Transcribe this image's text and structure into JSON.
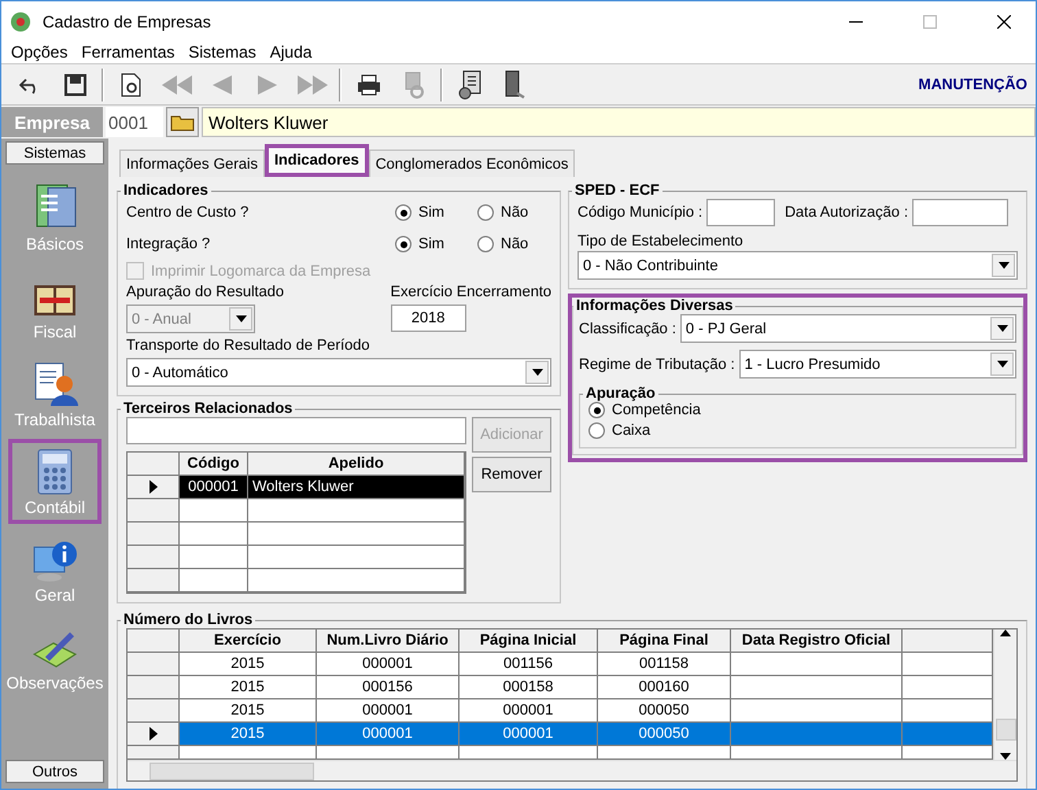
{
  "window": {
    "title": "Cadastro de Empresas"
  },
  "menu": [
    {
      "label": "Opções"
    },
    {
      "label": "Ferramentas"
    },
    {
      "label": "Sistemas"
    },
    {
      "label": "Ajuda"
    }
  ],
  "toolbar": {
    "buttons": [
      {
        "kind": "undo",
        "disabled": false
      },
      {
        "kind": "save",
        "disabled": false
      },
      {
        "kind": "sep"
      },
      {
        "kind": "preview",
        "disabled": false
      },
      {
        "kind": "first",
        "disabled": true
      },
      {
        "kind": "prev",
        "disabled": true
      },
      {
        "kind": "next",
        "disabled": true
      },
      {
        "kind": "last",
        "disabled": true
      },
      {
        "kind": "sep"
      },
      {
        "kind": "print",
        "disabled": false
      },
      {
        "kind": "tools",
        "disabled": true
      },
      {
        "kind": "sep"
      },
      {
        "kind": "report",
        "disabled": false
      },
      {
        "kind": "exit",
        "disabled": false
      }
    ],
    "mode": "MANUTENÇÃO"
  },
  "company": {
    "label": "Empresa",
    "code": "0001",
    "name": "Wolters Kluwer"
  },
  "sidebar": {
    "header": "Sistemas",
    "footer": "Outros",
    "items": [
      {
        "label": "Básicos",
        "kind": "basicos",
        "highlighted": false
      },
      {
        "label": "Fiscal",
        "kind": "fiscal",
        "highlighted": false
      },
      {
        "label": "Trabalhista",
        "kind": "trabalhista",
        "highlighted": false
      },
      {
        "label": "Contábil",
        "kind": "contabil",
        "highlighted": true
      },
      {
        "label": "Geral",
        "kind": "geral",
        "highlighted": false
      },
      {
        "label": "Observações",
        "kind": "observacoes",
        "highlighted": false
      }
    ]
  },
  "tabs": [
    {
      "label": "Informações Gerais",
      "selected": false,
      "highlighted": false
    },
    {
      "label": "Indicadores",
      "selected": true,
      "highlighted": true
    },
    {
      "label": "Conglomerados Econômicos",
      "selected": false,
      "highlighted": false
    }
  ],
  "indicadores": {
    "title": "Indicadores",
    "questions": [
      {
        "label": "Centro de Custo ?",
        "options": [
          {
            "label": "Sim",
            "selected": true
          },
          {
            "label": "Não",
            "selected": false
          }
        ]
      },
      {
        "label": "Integração ?",
        "options": [
          {
            "label": "Sim",
            "selected": true
          },
          {
            "label": "Não",
            "selected": false
          }
        ]
      }
    ],
    "logo_checkbox": {
      "label": "Imprimir Logomarca da Empresa",
      "checked": false,
      "disabled": true
    },
    "apuracao": {
      "label": "Apuração do Resultado",
      "value": "0 - Anual",
      "disabled": true
    },
    "exercicio": {
      "label": "Exercício Encerramento",
      "value": "2018"
    },
    "transporte": {
      "label": "Transporte do Resultado de Período",
      "value": "0 - Automático"
    }
  },
  "terceiros": {
    "title": "Terceiros Relacionados",
    "add_button": {
      "label": "Adicionar",
      "disabled": true
    },
    "remove_button": {
      "label": "Remover",
      "disabled": false
    },
    "columns": [
      "Código",
      "Apelido"
    ],
    "rows": [
      {
        "cells": [
          "000001",
          "Wolters Kluwer"
        ],
        "selected": true
      }
    ]
  },
  "sped": {
    "title": "SPED - ECF",
    "codigo_label": "Código Município :",
    "data_label": "Data Autorização :",
    "tipo_label": "Tipo de Estabelecimento",
    "tipo_value": "0 - Não Contribuinte"
  },
  "diversas": {
    "title": "Informações Diversas",
    "highlighted": true,
    "classificacao": {
      "label": "Classificação :",
      "value": "0 - PJ Geral"
    },
    "regime": {
      "label": "Regime de Tributação :",
      "value": "1 - Lucro Presumido"
    },
    "apuracao": {
      "title": "Apuração",
      "options": [
        {
          "label": "Competência",
          "selected": true
        },
        {
          "label": "Caixa",
          "selected": false
        }
      ]
    }
  },
  "livros": {
    "title": "Número do Livros",
    "columns": [
      "Exercício",
      "Num.Livro Diário",
      "Página Inicial",
      "Página Final",
      "Data Registro Oficial"
    ],
    "rows": [
      {
        "cells": [
          "2015",
          "000001",
          "001156",
          "001158"
        ],
        "selected": false
      },
      {
        "cells": [
          "2015",
          "000156",
          "000158",
          "000160"
        ],
        "selected": false
      },
      {
        "cells": [
          "2015",
          "000001",
          "000001",
          "000050"
        ],
        "selected": false
      },
      {
        "cells": [
          "2015",
          "000001",
          "000001",
          "000050"
        ],
        "selected": true
      }
    ]
  }
}
